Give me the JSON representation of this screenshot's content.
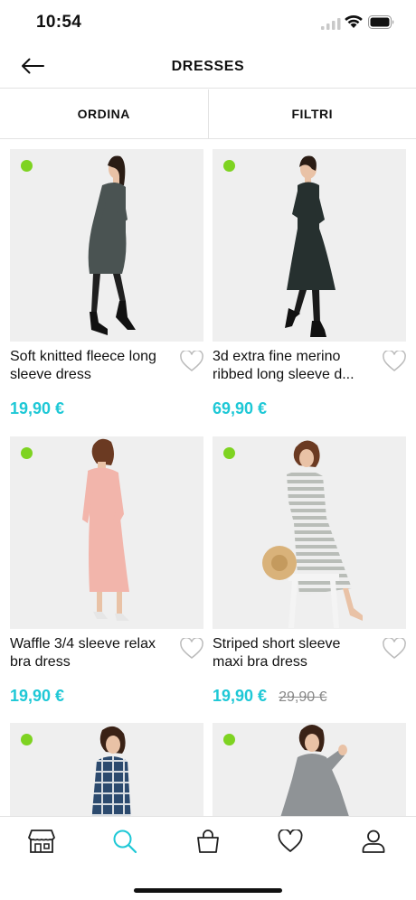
{
  "status_bar": {
    "time": "10:54"
  },
  "header": {
    "title": "DRESSES"
  },
  "toolbar": {
    "sort_label": "ORDINA",
    "filter_label": "FILTRI"
  },
  "colors": {
    "accent": "#1ec8d6",
    "available_dot": "#7ed321"
  },
  "products": [
    {
      "title": "Soft knitted fleece long sleeve dress",
      "price": "19,90 €",
      "old_price": "",
      "dress_color": "#4a5352"
    },
    {
      "title": "3d extra fine merino ribbed long sleeve d...",
      "price": "69,90 €",
      "old_price": "",
      "dress_color": "#26302f"
    },
    {
      "title": "Waffle 3/4 sleeve relax bra dress",
      "price": "19,90 €",
      "old_price": "",
      "dress_color": "#f2b5ab"
    },
    {
      "title": "Striped short sleeve maxi bra dress",
      "price": "19,90 €",
      "old_price": "29,90 €",
      "dress_color": "#b9bdb8"
    },
    {
      "title": "",
      "price": "",
      "old_price": "",
      "dress_color": "#2c4a6e"
    },
    {
      "title": "",
      "price": "",
      "old_price": "",
      "dress_color": "#8f9396"
    }
  ],
  "tab_bar": {
    "items": [
      {
        "icon": "store-icon"
      },
      {
        "icon": "search-icon",
        "active": true
      },
      {
        "icon": "shopping-bag-icon"
      },
      {
        "icon": "heart-icon"
      },
      {
        "icon": "profile-icon"
      }
    ]
  }
}
